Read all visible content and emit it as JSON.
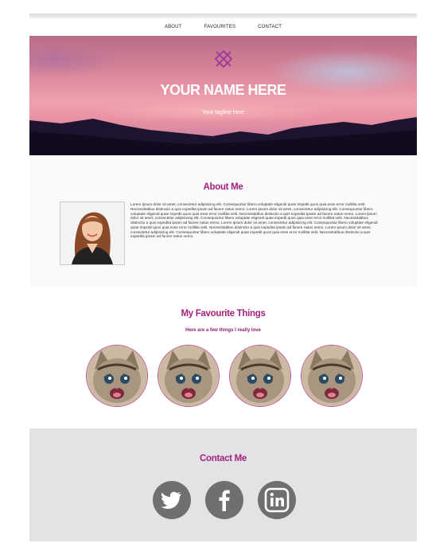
{
  "nav": {
    "items": [
      {
        "label": "ABOUT"
      },
      {
        "label": "FAVOURITES"
      },
      {
        "label": "CONTACT"
      }
    ]
  },
  "hero": {
    "title": "YOUR NAME HERE",
    "tagline": "Your tagline here",
    "logo_icon": "diamond-x-icon"
  },
  "about": {
    "heading": "About Me",
    "body": "Lorem ipsum dolor sit amet, consectetur adipisicing elit. Consequuntur libero voluptate eligendi quae impedit quos quia esse error mollitia velit. Necessitatibus distinctio a quis expedita ipsam ad facere natus nemo. Lorem ipsum dolor sit amet, consectetur adipisicing elit. Consequuntur libero voluptate eligendi quae impedit quos quia esse error mollitia velit. Necessitatibus distinctio a quis expedita ipsam ad facere natus nemo. Lorem ipsum dolor sit amet, consectetur adipisicing elit. Consequuntur libero voluptate eligendi quae impedit quos quia esse error mollitia velit. Necessitatibus distinctio a quis expedita ipsam ad facere natus nemo. Lorem ipsum dolor sit amet, consectetur adipisicing elit. Consequuntur libero voluptate eligendi quae impedit quos quia esse error mollitia velit. Necessitatibus distinctio a quis expedita ipsam ad facere natus nemo. Lorem ipsum dolor sit amet, consectetur adipisicing elit. Consequuntur libero voluptate eligendi quae impedit quos quia esse error mollitia velit. Necessitatibus distinctio a quis expedita ipsam ad facere natus nemo."
  },
  "favourites": {
    "heading": "My Favourite Things",
    "subheading": "Here are a few things I really love",
    "items": [
      {
        "icon": "kitten-photo"
      },
      {
        "icon": "kitten-photo"
      },
      {
        "icon": "kitten-photo"
      },
      {
        "icon": "kitten-photo"
      }
    ]
  },
  "contact": {
    "heading": "Contact Me",
    "social": [
      {
        "icon": "twitter-icon"
      },
      {
        "icon": "facebook-icon"
      },
      {
        "icon": "linkedin-icon"
      }
    ]
  },
  "colors": {
    "accent": "#a3227f",
    "social_grey": "#6f6f6f",
    "contact_bg": "#e3e2e4"
  }
}
